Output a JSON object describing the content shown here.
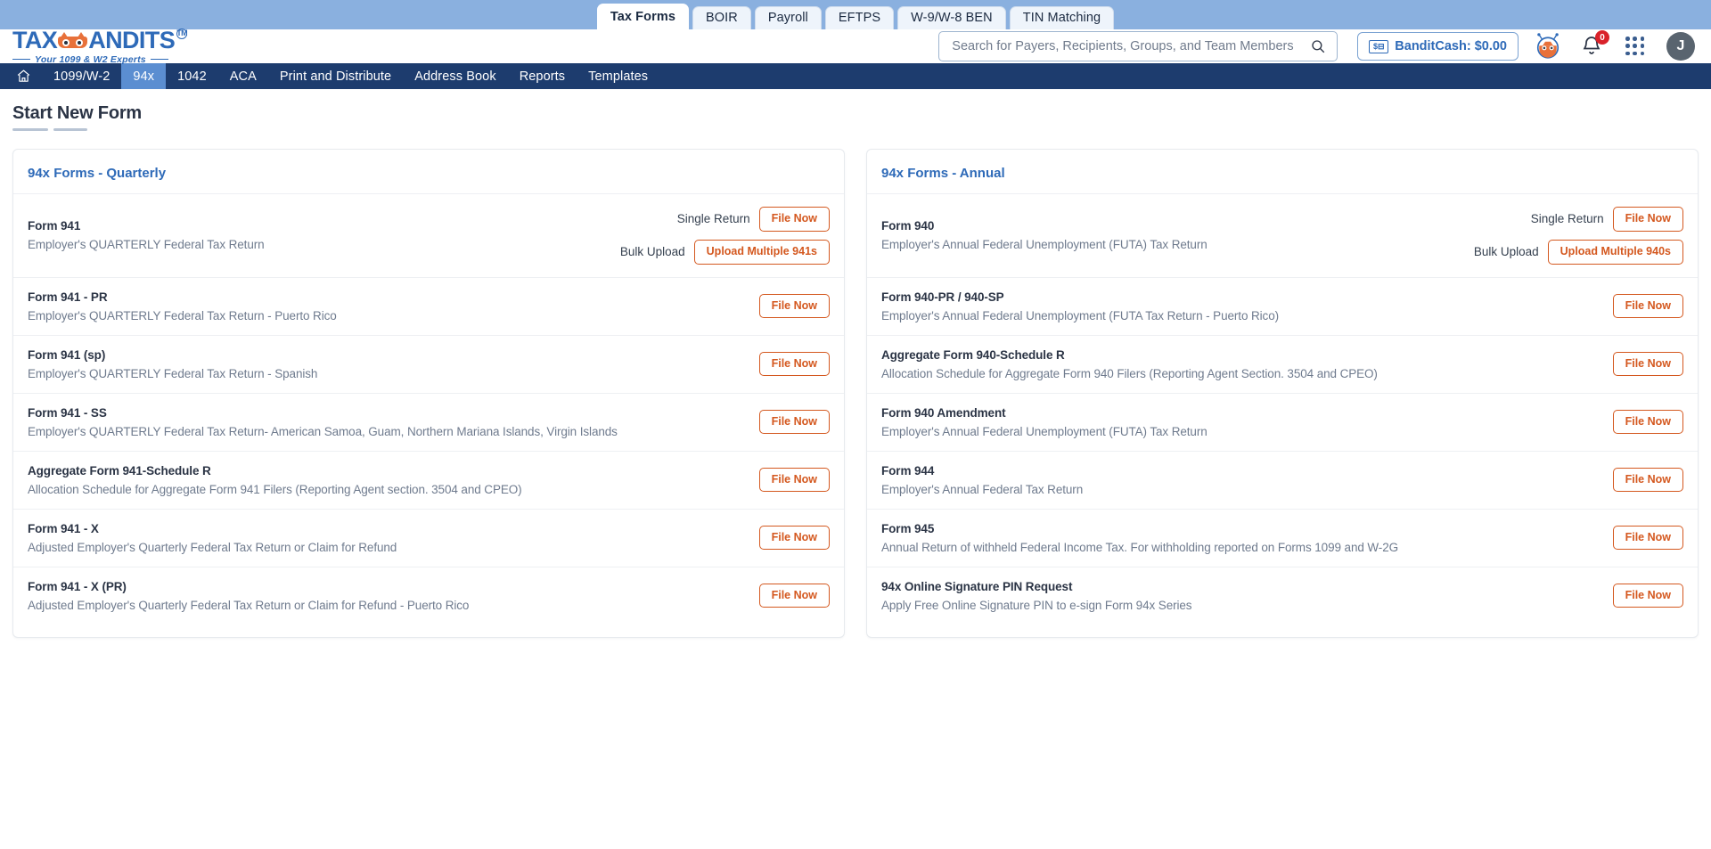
{
  "product_tabs": [
    {
      "label": "Tax Forms",
      "active": true
    },
    {
      "label": "BOIR",
      "active": false
    },
    {
      "label": "Payroll",
      "active": false
    },
    {
      "label": "EFTPS",
      "active": false
    },
    {
      "label": "W-9/W-8 BEN",
      "active": false
    },
    {
      "label": "TIN Matching",
      "active": false
    }
  ],
  "brand": {
    "name_left": "TAX",
    "name_right": "ANDITS",
    "trademark": "TM",
    "tagline": "Your 1099 & W2 Experts"
  },
  "search": {
    "placeholder": "Search for Payers, Recipients, Groups, and Team Members",
    "value": ""
  },
  "header": {
    "bandit_cash_label": "BanditCash: $0.00",
    "bandit_cash_icon_text": "$",
    "notification_count": "0",
    "avatar_initial": "J"
  },
  "nav": [
    {
      "label": "",
      "icon": "home-icon",
      "active": false,
      "name": "nav-home"
    },
    {
      "label": "1099/W-2",
      "active": false,
      "name": "nav-1099-w2"
    },
    {
      "label": "94x",
      "active": true,
      "name": "nav-94x"
    },
    {
      "label": "1042",
      "active": false,
      "name": "nav-1042"
    },
    {
      "label": "ACA",
      "active": false,
      "name": "nav-aca"
    },
    {
      "label": "Print and Distribute",
      "active": false,
      "name": "nav-print-and-distribute"
    },
    {
      "label": "Address Book",
      "active": false,
      "name": "nav-address-book"
    },
    {
      "label": "Reports",
      "active": false,
      "name": "nav-reports"
    },
    {
      "label": "Templates",
      "active": false,
      "name": "nav-templates"
    }
  ],
  "page": {
    "title": "Start New Form"
  },
  "labels": {
    "single_return": "Single Return",
    "bulk_upload": "Bulk Upload",
    "file_now": "File Now"
  },
  "quarterly": {
    "title": "94x Forms - Quarterly",
    "rows": [
      {
        "name": "Form 941",
        "desc": "Employer's QUARTERLY Federal Tax Return",
        "single_label": "Single Return",
        "single_button": "File Now",
        "bulk_label": "Bulk Upload",
        "bulk_button": "Upload Multiple 941s"
      },
      {
        "name": "Form 941 - PR",
        "desc": "Employer's QUARTERLY Federal Tax Return - Puerto Rico",
        "single_button": "File Now"
      },
      {
        "name": "Form 941 (sp)",
        "desc": "Employer's QUARTERLY Federal Tax Return - Spanish",
        "single_button": "File Now"
      },
      {
        "name": "Form 941 - SS",
        "desc": "Employer's QUARTERLY Federal Tax Return- American Samoa, Guam, Northern Mariana Islands, Virgin Islands",
        "single_button": "File Now"
      },
      {
        "name": "Aggregate Form 941-Schedule R",
        "desc": "Allocation Schedule for Aggregate Form 941 Filers (Reporting Agent section. 3504 and CPEO)",
        "single_button": "File Now"
      },
      {
        "name": "Form 941 - X",
        "desc": "Adjusted Employer's Quarterly Federal Tax Return or Claim for Refund",
        "single_button": "File Now"
      },
      {
        "name": "Form 941 - X (PR)",
        "desc": "Adjusted Employer's Quarterly Federal Tax Return or Claim for Refund - Puerto Rico",
        "single_button": "File Now"
      }
    ]
  },
  "annual": {
    "title": "94x Forms - Annual",
    "rows": [
      {
        "name": "Form 940",
        "desc": "Employer's Annual Federal Unemployment (FUTA) Tax Return",
        "single_label": "Single Return",
        "single_button": "File Now",
        "bulk_label": "Bulk Upload",
        "bulk_button": "Upload Multiple 940s"
      },
      {
        "name": "Form 940-PR / 940-SP",
        "desc": "Employer's Annual Federal Unemployment (FUTA Tax Return - Puerto Rico)",
        "single_button": "File Now"
      },
      {
        "name": "Aggregate Form 940-Schedule R",
        "desc": "Allocation Schedule for Aggregate Form 940 Filers (Reporting Agent Section. 3504 and CPEO)",
        "single_button": "File Now"
      },
      {
        "name": "Form 940 Amendment",
        "desc": "Employer's Annual Federal Unemployment (FUTA) Tax Return",
        "single_button": "File Now"
      },
      {
        "name": "Form 944",
        "desc": "Employer's Annual Federal Tax Return",
        "single_button": "File Now"
      },
      {
        "name": "Form 945",
        "desc": "Annual Return of withheld Federal Income Tax. For withholding reported on Forms 1099 and W-2G",
        "single_button": "File Now"
      },
      {
        "name": "94x Online Signature PIN Request",
        "desc": "Apply Free Online Signature PIN to e-sign Form 94x Series",
        "single_button": "File Now"
      }
    ]
  },
  "colors": {
    "brand_blue": "#2e6ab8",
    "nav_blue": "#1d3c6e",
    "nav_active": "#5b8ed1",
    "accent_orange": "#d4581f",
    "badge_red": "#d9222a",
    "strip_blue": "#8ab0df"
  }
}
